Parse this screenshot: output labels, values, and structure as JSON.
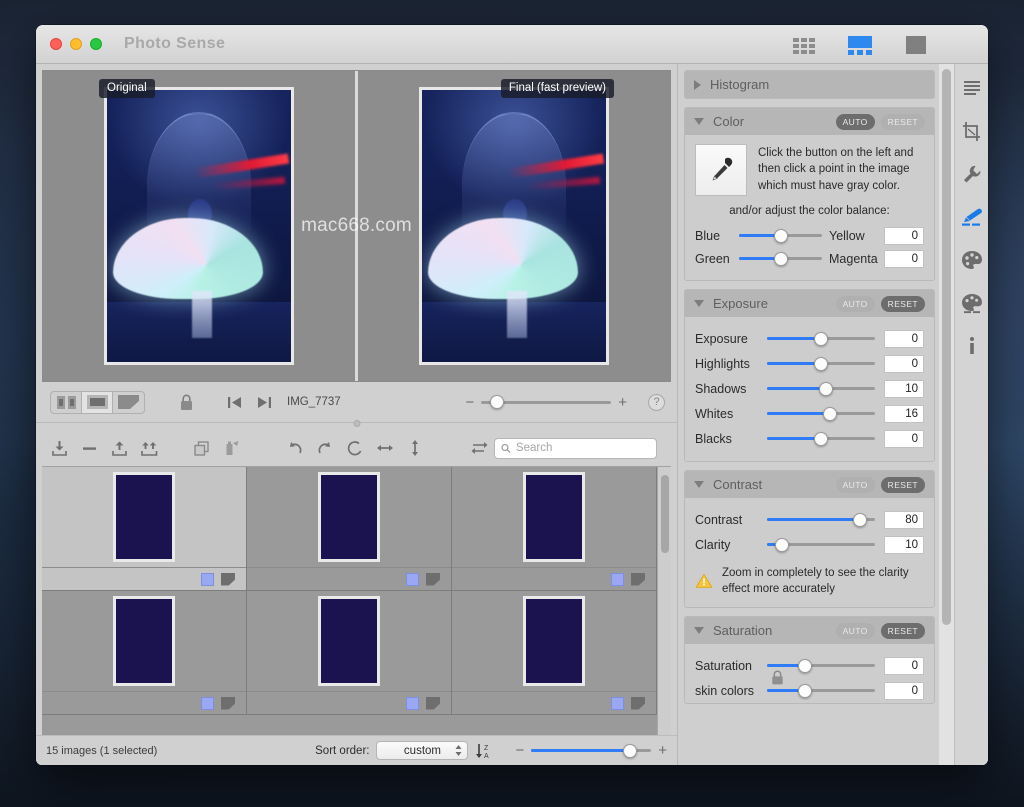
{
  "window": {
    "title": "Photo Sense",
    "traffic_lights": [
      "close",
      "minimize",
      "zoom"
    ],
    "view_modes": [
      {
        "name": "grid-view",
        "active": false
      },
      {
        "name": "split-view",
        "active": true
      },
      {
        "name": "single-view",
        "active": false
      }
    ]
  },
  "preview": {
    "left_label": "Original",
    "right_label": "Final (fast preview)",
    "watermark": "mac668.com",
    "toolbar": {
      "compare_modes": [
        {
          "name": "side-by-side",
          "active": false
        },
        {
          "name": "single-image",
          "active": true
        },
        {
          "name": "corner-split",
          "active": false
        }
      ],
      "lock_icon": "lock-icon",
      "prev_label": "previous-image",
      "next_label": "next-image",
      "image_name": "IMG_7737",
      "zoom_minus": "−",
      "zoom_plus": "+",
      "zoom_percent": 12,
      "help_label": "?"
    }
  },
  "browser_toolbar": {
    "buttons": [
      {
        "name": "import-icon",
        "label": "Import"
      },
      {
        "name": "remove-icon",
        "label": "Remove"
      },
      {
        "name": "export-icon",
        "label": "Export"
      },
      {
        "name": "export-all-icon",
        "label": "Export All"
      },
      {
        "name": "duplicate-icon",
        "label": "Duplicate"
      },
      {
        "name": "copy-settings-icon",
        "label": "Copy Settings"
      },
      {
        "name": "rotate-left-icon",
        "label": "Rotate Left"
      },
      {
        "name": "rotate-right-icon",
        "label": "Rotate Right"
      },
      {
        "name": "rotate-free-icon",
        "label": "Rotate"
      },
      {
        "name": "flip-horizontal-icon",
        "label": "Flip Horizontal"
      },
      {
        "name": "flip-vertical-icon",
        "label": "Flip Vertical"
      },
      {
        "name": "reset-transform-icon",
        "label": "Reset"
      }
    ],
    "search_placeholder": "Search",
    "search_value": ""
  },
  "grid": {
    "cells": [
      {
        "selected": true,
        "badge1": "edited-badge",
        "badge2": "crop-badge"
      },
      {
        "selected": false,
        "badge1": "edited-badge",
        "badge2": "crop-badge"
      },
      {
        "selected": false,
        "badge1": "edited-badge",
        "badge2": "crop-badge"
      },
      {
        "selected": false,
        "badge1": "edited-badge",
        "badge2": "crop-badge"
      },
      {
        "selected": false,
        "badge1": "edited-badge",
        "badge2": "crop-badge"
      },
      {
        "selected": false,
        "badge1": "edited-badge",
        "badge2": "crop-badge"
      }
    ]
  },
  "statusbar": {
    "count_text": "15 images (1 selected)",
    "sort_label": "Sort order:",
    "sort_value": "custom",
    "sort_direction_icon": "sort-descending-icon",
    "zoom_minus": "−",
    "zoom_plus": "+",
    "thumb_zoom_percent": 82
  },
  "panels": {
    "histogram": {
      "title": "Histogram",
      "expanded": false
    },
    "color": {
      "title": "Color",
      "expanded": true,
      "auto_label": "AUTO",
      "auto_active": true,
      "reset_label": "RESET",
      "reset_active": false,
      "eyedropper_icon": "eyedropper-icon",
      "instructions": "Click the button on the left and then click a point in the image which must have gray color.",
      "balance_title": "and/or adjust the color balance:",
      "balance": [
        {
          "left_label": "Blue",
          "right_label": "Yellow",
          "value": 0,
          "position": 50
        },
        {
          "left_label": "Green",
          "right_label": "Magenta",
          "value": 0,
          "position": 50
        }
      ]
    },
    "exposure": {
      "title": "Exposure",
      "expanded": true,
      "auto_label": "AUTO",
      "auto_active": false,
      "reset_label": "RESET",
      "reset_active": true,
      "controls": [
        {
          "label": "Exposure",
          "value": 0,
          "position": 50
        },
        {
          "label": "Highlights",
          "value": 0,
          "position": 50
        },
        {
          "label": "Shadows",
          "value": 10,
          "position": 55
        },
        {
          "label": "Whites",
          "value": 16,
          "position": 58
        },
        {
          "label": "Blacks",
          "value": 0,
          "position": 50
        }
      ]
    },
    "contrast": {
      "title": "Contrast",
      "expanded": true,
      "auto_label": "AUTO",
      "auto_active": false,
      "reset_label": "RESET",
      "reset_active": true,
      "controls": [
        {
          "label": "Contrast",
          "value": 80,
          "position": 86
        },
        {
          "label": "Clarity",
          "value": 10,
          "position": 14
        }
      ],
      "warning_icon": "warning-triangle-icon",
      "warning_text": "Zoom in completely to see the clarity effect more accurately"
    },
    "saturation": {
      "title": "Saturation",
      "expanded": true,
      "auto_label": "AUTO",
      "auto_active": false,
      "reset_label": "RESET",
      "reset_active": true,
      "controls": [
        {
          "label": "Saturation",
          "value": 0,
          "position": 35,
          "locked": false
        },
        {
          "label": "skin colors",
          "value": 0,
          "position": 35,
          "locked": true
        }
      ],
      "lock_icon": "lock-icon"
    }
  },
  "toolstrip": {
    "tools": [
      {
        "name": "levels-icon",
        "active": false
      },
      {
        "name": "crop-icon",
        "active": false
      },
      {
        "name": "wrench-icon",
        "active": false
      },
      {
        "name": "brush-icon",
        "active": true
      },
      {
        "name": "palette-icon",
        "active": false
      },
      {
        "name": "palette-mix-icon",
        "active": false
      },
      {
        "name": "info-icon",
        "active": false
      }
    ],
    "accent_color": "#1a7ae8"
  }
}
